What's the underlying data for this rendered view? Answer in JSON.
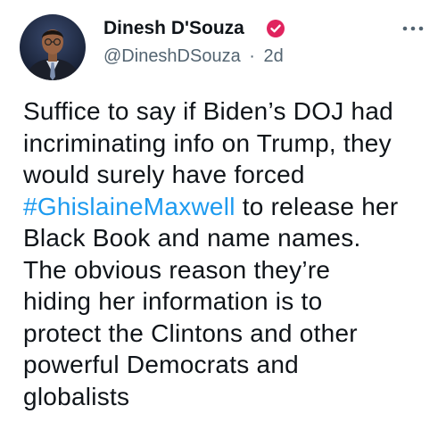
{
  "author": {
    "display_name": "Dinesh D'Souza",
    "handle": "@DineshDSouza",
    "separator": "·",
    "time": "2d",
    "avatar_icon": "profile-photo",
    "verified_icon": "verified-badge-icon"
  },
  "more_icon": "more-options-icon",
  "tweet": {
    "lines": [
      {
        "text": "Suffice to say if Biden’s DOJ had"
      },
      {
        "text": "incriminating info on Trump, they"
      },
      {
        "text": "would surely have forced"
      },
      {
        "hashtag": "#GhislaineMaxwell",
        "text": " to release her"
      },
      {
        "text": "Black Book and name names."
      },
      {
        "text": "The obvious reason they’re"
      },
      {
        "text": "hiding her information is to"
      },
      {
        "text": "protect the Clintons and other"
      },
      {
        "text": "powerful Democrats and"
      },
      {
        "text": "globalists"
      }
    ]
  },
  "colors": {
    "text": "#0f1419",
    "secondary": "#536471",
    "link": "#1d9bf0",
    "badge": "#e0245e"
  }
}
